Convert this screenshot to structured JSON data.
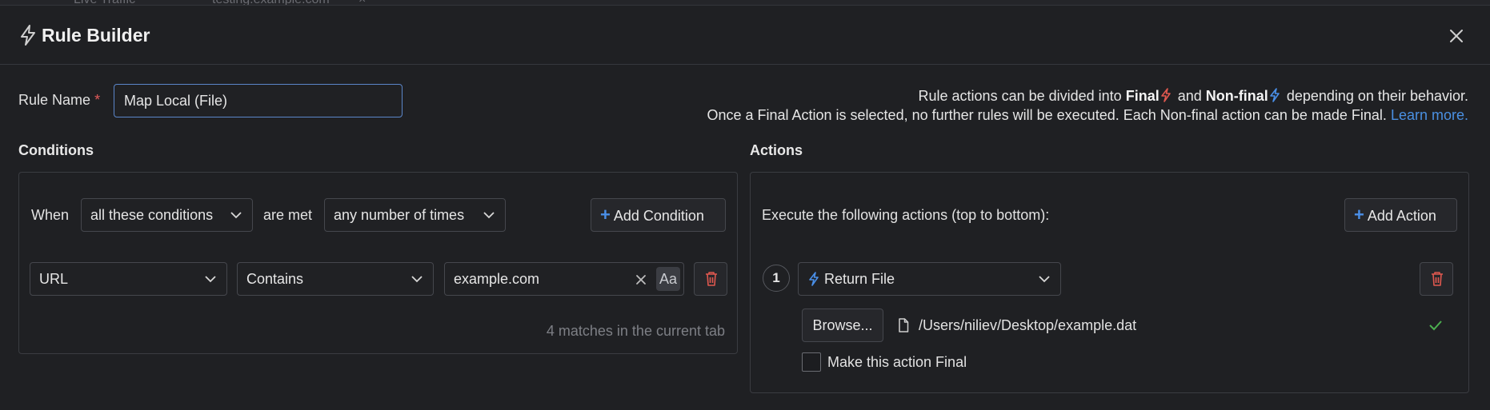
{
  "backdrop": {
    "tab1": "Live Traffic",
    "tab2": "testing.example.com",
    "tab2_close": "×"
  },
  "dialog": {
    "title": "Rule Builder"
  },
  "rule_name": {
    "label": "Rule Name",
    "required_mark": "*",
    "value": "Map Local (File)"
  },
  "info": {
    "line1_prefix": "Rule actions can be divided into",
    "final_label": "Final",
    "and": "and",
    "nonfinal_label": "Non-final",
    "line1_suffix": "depending on their behavior.",
    "line2": "Once a Final Action is selected, no further rules will be executed. Each Non-final action can be made Final.",
    "learn_more": "Learn more.",
    "final_color": "#e0584f",
    "nonfinal_color": "#4a8fe8"
  },
  "conditions": {
    "title": "Conditions",
    "when": "When",
    "match_mode": "all these conditions",
    "are_met": "are met",
    "frequency": "any number of times",
    "add_button": "Add Condition",
    "row": {
      "field": "URL",
      "operator": "Contains",
      "value": "example.com",
      "case_toggle": "Aa"
    },
    "matches_text": "4 matches in the current tab"
  },
  "actions": {
    "title": "Actions",
    "intro": "Execute the following actions (top to bottom):",
    "add_button": "Add Action",
    "items": [
      {
        "index": "1",
        "type": "Return File",
        "browse_label": "Browse...",
        "file_path": "/Users/niliev/Desktop/example.dat",
        "make_final_label": "Make this action Final",
        "make_final_checked": false
      }
    ]
  },
  "colors": {
    "accent": "#4a8fe8",
    "danger": "#e0584f",
    "success": "#4caf50"
  }
}
